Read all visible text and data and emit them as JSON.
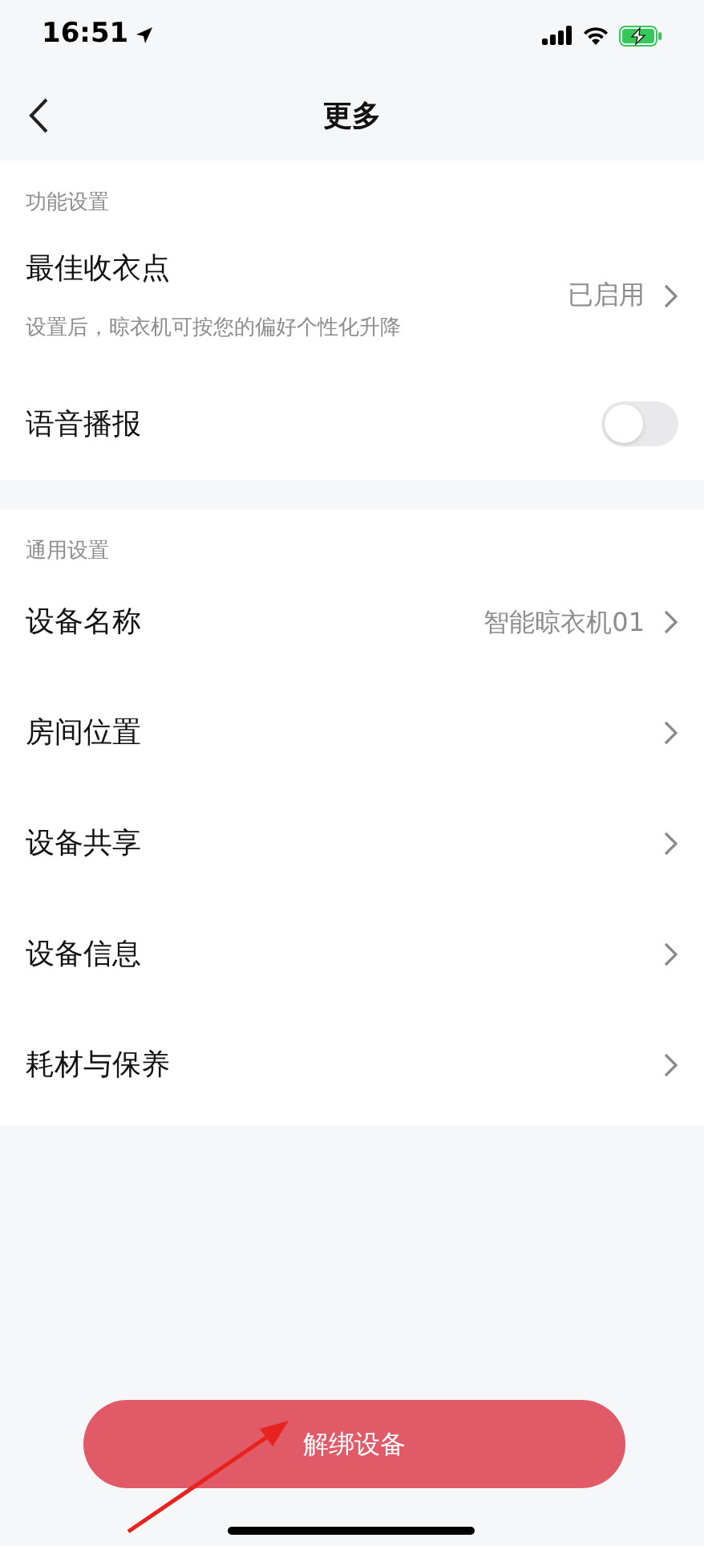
{
  "status_bar": {
    "time": "16:51"
  },
  "header": {
    "title": "更多"
  },
  "sections": [
    {
      "label": "功能设置",
      "rows": [
        {
          "kind": "link",
          "title": "最佳收衣点",
          "subtitle": "设置后，晾衣机可按您的偏好个性化升降",
          "value": "已启用"
        },
        {
          "kind": "toggle",
          "title": "语音播报",
          "on": false
        }
      ]
    },
    {
      "label": "通用设置",
      "rows": [
        {
          "kind": "link",
          "title": "设备名称",
          "value": "智能晾衣机01"
        },
        {
          "kind": "link",
          "title": "房间位置"
        },
        {
          "kind": "link",
          "title": "设备共享"
        },
        {
          "kind": "link",
          "title": "设备信息"
        },
        {
          "kind": "link",
          "title": "耗材与保养"
        }
      ]
    }
  ],
  "unbind_button": {
    "label": "解绑设备"
  }
}
